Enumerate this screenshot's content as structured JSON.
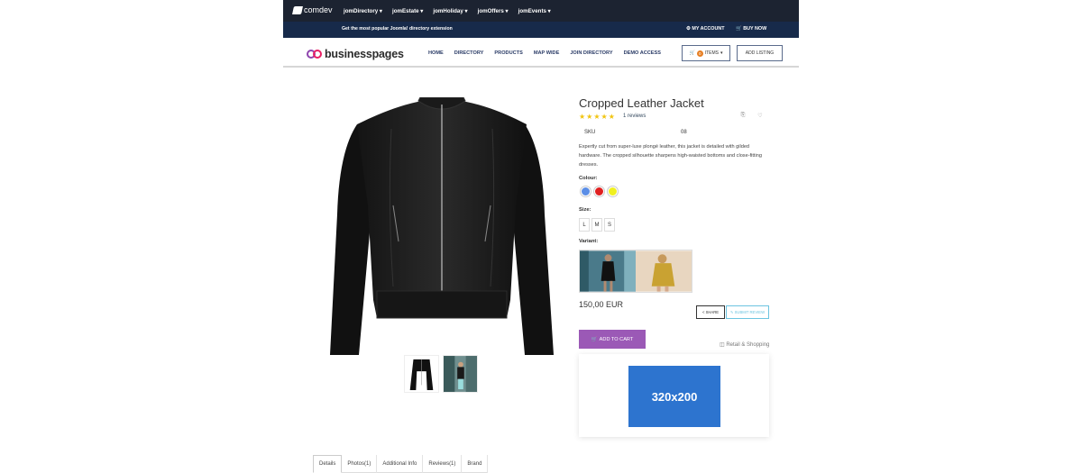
{
  "topbar": {
    "logo": "comdev",
    "menu": [
      "jomDirectory",
      "jomEstate",
      "jomHoliday",
      "jomOffers",
      "jomEvents"
    ]
  },
  "strip": {
    "tagline": "Get the most popular Joomla! directory extension",
    "my_account": "MY ACCOUNT",
    "buy_now": "BUY NOW"
  },
  "header": {
    "logo_prefix": "business",
    "logo_suffix": "pages",
    "nav": [
      "HOME",
      "DIRECTORY",
      "PRODUCTS",
      "MAP WIDE",
      "JOIN DIRECTORY",
      "DEMO ACCESS"
    ],
    "cart_count": "0",
    "cart_label": "ITEMS",
    "add_listing": "ADD LISTING"
  },
  "product": {
    "title": "Cropped Leather Jacket",
    "rating": 5,
    "reviews_link": "1 reviews",
    "sku_label": "SKU",
    "sku_value": "08",
    "description": "Expertly cut from super-luxe plongé leather, this jacket is detailed with gilded hardware. The cropped silhouette sharpens high-waisted bottoms and close-fitting dresses.",
    "colour_label": "Colour:",
    "colours": [
      "#5b8ee6",
      "#e02020",
      "#f0f020"
    ],
    "size_label": "Size:",
    "sizes": [
      "L",
      "M",
      "S"
    ],
    "variant_label": "Variant:",
    "price": "150,00 EUR",
    "share": "SHARE",
    "submit_review": "SUBMIT REVIEW",
    "add_to_cart": "ADD TO CART",
    "category": "Retail & Shopping",
    "ad_text": "320x200"
  },
  "tabs": [
    "Details",
    "Photos(1)",
    "Additional Info",
    "Reviews(1)",
    "Brand"
  ]
}
